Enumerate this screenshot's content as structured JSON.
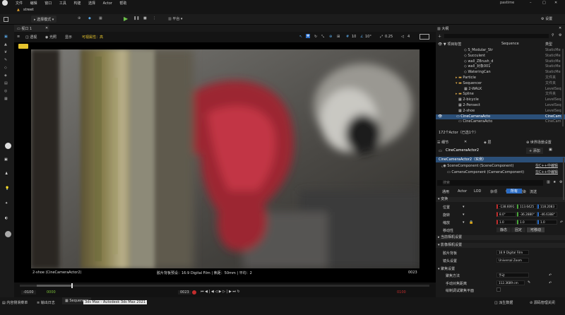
{
  "menu": {
    "items": [
      "文件",
      "编辑",
      "窗口",
      "工具",
      "构建",
      "选择",
      "Actor",
      "帮助"
    ],
    "project": "pastime"
  },
  "tabs": {
    "level": "street"
  },
  "toolbar": {
    "select_mode": "选择模式",
    "platform": "平台",
    "settings": "设置"
  },
  "viewport": {
    "tab": "视口 1",
    "perspective": "透视",
    "lit": "光照",
    "show": "显示",
    "visualizer": "可视属性：高",
    "grid_snap": "10",
    "angle_snap": "10°",
    "scale_snap": "0.25",
    "cam_speed": "4",
    "camera_label": "2-shoe (CineCameraActor2)",
    "film_info": "胶片背板预设：16:9 Digital Film | 焦距：50mm | 平均：2",
    "frame": "0023"
  },
  "timeline": {
    "start": "-0100",
    "start_right": "0000",
    "frame": "0023",
    "end": "0100"
  },
  "statusbar": {
    "content_drawer": "内容侧滑菜单",
    "output_log": "输出日志",
    "sequencer": "Sequencer",
    "tooltip": "3ds Max - Autodesk 3ds Max 2021",
    "derived": "派生数据",
    "source_control": "源码管理关闭"
  },
  "outliner": {
    "tab": "大纲",
    "header_label": "项目标签",
    "header_type": "类型",
    "col_sequence": "Sequence",
    "rows": [
      {
        "label": "S_Modular_Str",
        "type": "StaticMe"
      },
      {
        "label": "Succulent",
        "type": "StaticMe"
      },
      {
        "label": "wall_ZBrush_d",
        "type": "StaticMe"
      },
      {
        "label": "wall_对象001",
        "type": "StaticMe"
      },
      {
        "label": "WateringCan",
        "type": "StaticMe"
      },
      {
        "label": "Particle",
        "type": "文件夹"
      },
      {
        "label": "Sequencer",
        "type": "文件夹"
      },
      {
        "label": "2-WALK",
        "type": "LevelSeq"
      },
      {
        "label": "Spline",
        "type": "文件夹"
      },
      {
        "label": "2-bicycle",
        "type": "LevelSeq"
      },
      {
        "label": "2-Pensect",
        "type": "LevelSeq"
      },
      {
        "label": "2-shoe",
        "type": "LevelSeq"
      },
      {
        "label": "CineCameraActo",
        "type": "CineCam"
      },
      {
        "label": "CineCameraActo",
        "type": "CineCam"
      }
    ],
    "footer": "172个Actor（已选1个）"
  },
  "details": {
    "tab_details": "细节",
    "tab_layers": "层",
    "tab_world": "世界场景设置",
    "actor_name": "CineCameraActor2",
    "add_button": "+ 添加",
    "root_component": "CineCameraActor2（实例）",
    "component1": "SceneComponent (SceneComponent)",
    "component2": "CameraComponent (CameraComponent)",
    "edit_cpp": "在C++中编辑",
    "search_placeholder": "搜索",
    "filters": [
      "通用",
      "Actor",
      "LOD",
      "杂项",
      "物理",
      "渲染",
      "流送",
      "所有"
    ],
    "section_transform": "变换",
    "location_label": "位置",
    "rotation_label": "旋转",
    "scale_label": "缩放",
    "location": [
      "-138.6091",
      "113.6425",
      "118.2083"
    ],
    "rotation": [
      "8.0°",
      "-36.2880°",
      "-46.6388°"
    ],
    "scale": [
      "1.0",
      "1.0",
      "1.0"
    ],
    "mobility_label": "移动性",
    "mobility_options": [
      "静态",
      "固定",
      "可移动"
    ],
    "section_current_camera": "当前相机设置",
    "section_camera_settings": "影像相机设置",
    "filmback_label": "胶片背板",
    "filmback_value": "16:9 Digital Film",
    "lens_label": "镜头设置",
    "lens_value": "Universal Zoom",
    "section_focus": "聚焦设置",
    "focus_method_label": "聚焦方法",
    "focus_method_value": "手动",
    "focus_distance_label": "手动对焦距离",
    "focus_distance_value": "112.3689 cm",
    "smooth_focus_label": "绘制调试聚焦平面"
  },
  "colors": {
    "accent": "#2b6cc4",
    "selection": "#2b4f78",
    "record": "#c22d2d",
    "badge": "#e6c42e"
  }
}
